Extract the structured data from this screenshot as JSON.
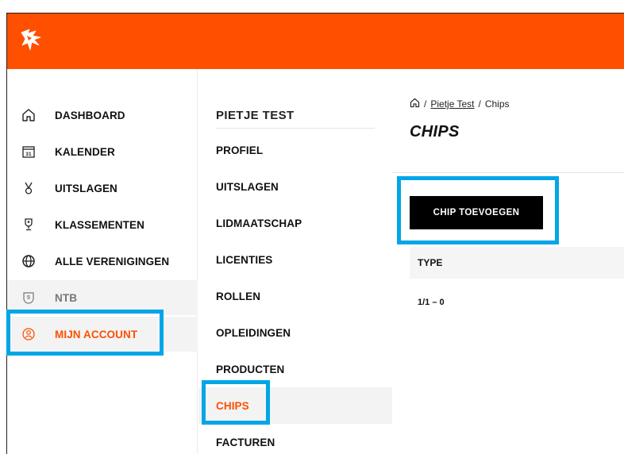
{
  "colors": {
    "brand": "#ff5000",
    "highlight": "#00a6e6",
    "button_bg": "#000000"
  },
  "sidebar": {
    "items": [
      {
        "label": "DASHBOARD",
        "icon": "home-icon"
      },
      {
        "label": "KALENDER",
        "icon": "calendar-icon",
        "icon_text": "31"
      },
      {
        "label": "UITSLAGEN",
        "icon": "medal-icon"
      },
      {
        "label": "KLASSEMENTEN",
        "icon": "trophy-icon"
      },
      {
        "label": "ALLE VERENIGINGEN",
        "icon": "globe-icon"
      },
      {
        "label": "NTB",
        "icon": "shield-icon",
        "icon_text": "5"
      },
      {
        "label": "MIJN ACCOUNT",
        "icon": "user-circle-icon"
      }
    ]
  },
  "subnav": {
    "title": "PIETJE TEST",
    "items": [
      "PROFIEL",
      "UITSLAGEN",
      "LIDMAATSCHAP",
      "LICENTIES",
      "ROLLEN",
      "OPLEIDINGEN",
      "PRODUCTEN",
      "CHIPS",
      "FACTUREN"
    ]
  },
  "main": {
    "breadcrumb": {
      "sep": "/",
      "link": "Pietje Test",
      "current": "Chips"
    },
    "title": "CHIPS",
    "add_button": "CHIP TOEVOEGEN",
    "table": {
      "columns": [
        "TYPE"
      ],
      "rows": [
        [
          "1/1 – 0"
        ]
      ]
    }
  }
}
